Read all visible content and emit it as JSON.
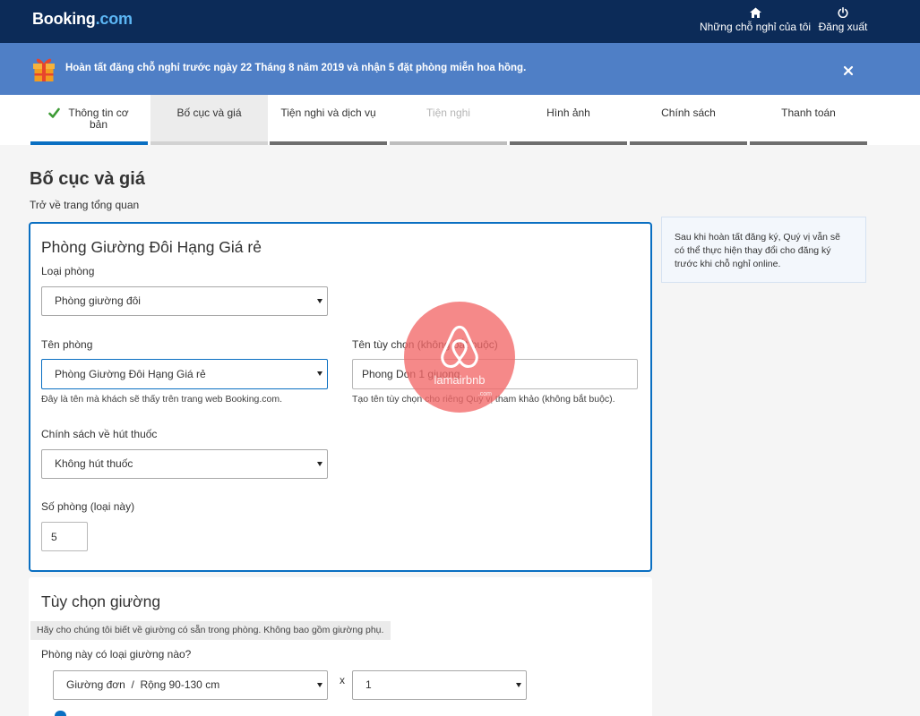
{
  "theme": {
    "header_bg": "#0c2b58",
    "banner_bg": "#4f7fc6",
    "accent": "#0a6fc2",
    "check_green": "#3d9b35",
    "watermark": "#f26868"
  },
  "header": {
    "logo_main": "Booking",
    "logo_suffix": ".com",
    "nav": [
      {
        "label": "Những chỗ nghỉ của tôi",
        "icon": "home-icon"
      },
      {
        "label": "Đăng xuất",
        "icon": "power-icon"
      }
    ]
  },
  "banner": {
    "icon": "gift-icon",
    "text": "Hoàn tất đăng chỗ nghỉ trước ngày 22 Tháng 8 năm 2019 và nhận 5 đặt phòng miễn hoa hồng.",
    "close_icon": "close-icon"
  },
  "steps": [
    {
      "label": "Thông tin cơ bản",
      "icon": "check-icon"
    },
    {
      "label": "Bố cục và giá"
    },
    {
      "label": "Tiện nghi và dịch vụ"
    },
    {
      "label": "Tiện nghi"
    },
    {
      "label": "Hình ảnh"
    },
    {
      "label": "Chính sách"
    },
    {
      "label": "Thanh toán"
    }
  ],
  "page": {
    "title": "Bố cục và giá",
    "back_link": "Trở về trang tổng quan"
  },
  "room_card": {
    "title": "Phòng Giường Đôi Hạng Giá rẻ",
    "room_type": {
      "label": "Loại phòng",
      "value": "Phòng giường đôi"
    },
    "room_name": {
      "label": "Tên phòng",
      "value": "Phòng Giường Đôi Hạng Giá rẻ",
      "help": "Đây là tên mà khách sẽ thấy trên trang web Booking.com."
    },
    "custom_name": {
      "label": "Tên tùy chọn (không bắt buộc)",
      "value": "Phong Don 1 giuong",
      "help": "Tạo tên tùy chọn cho riêng Quý vị tham khảo (không bắt buộc)."
    },
    "smoking": {
      "label": "Chính sách về hút thuốc",
      "value": "Không hút thuốc"
    },
    "room_count": {
      "label": "Số phòng (loại này)",
      "value": "5"
    }
  },
  "bed_card": {
    "title": "Tùy chọn giường",
    "note": "Hãy cho chúng tôi biết về giường có sẵn trong phòng. Không bao gồm giường phụ.",
    "question": "Phòng này có loại giường nào?",
    "bed_type": "Giường đơn  /  Rộng 90-130 cm",
    "multiplier": "x",
    "bed_count": "1"
  },
  "sidebar": {
    "tip": "Sau khi hoàn tất đăng ký, Quý vị vẫn sẽ có thể thực hiện thay đổi cho đăng ký trước khi chỗ nghỉ online."
  },
  "watermark": {
    "brand": "lamairbnb",
    "suffix": ".com"
  }
}
